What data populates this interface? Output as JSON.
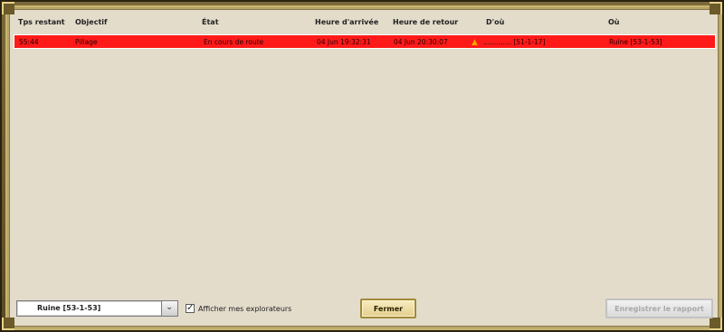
{
  "table": {
    "columns": [
      "Tps restant",
      "Objectif",
      "État",
      "Heure d'arrivée",
      "Heure de retour",
      "D'où",
      "Où"
    ],
    "rows": [
      {
        "remaining": "55:44",
        "objective": "Pillage",
        "state": "En cours de route",
        "arrival": "04 Jun 19:32:31",
        "return": "04 Jun 20:30:07",
        "from": "............. [51-1-17]",
        "to": "Ruine [53-1-53]",
        "from_icon": "flame-icon"
      }
    ]
  },
  "footer": {
    "dropdown_value": "Ruine [53-1-53]",
    "checkbox_label": "Afficher mes explorateurs",
    "checkbox_checked": true,
    "close_label": "Fermer",
    "save_report_label": "Enregistrer le rapport"
  },
  "colors": {
    "row_highlight": "#ff1a1a",
    "panel_bg": "#e3dccb",
    "frame_gold": "#c8b46e"
  }
}
